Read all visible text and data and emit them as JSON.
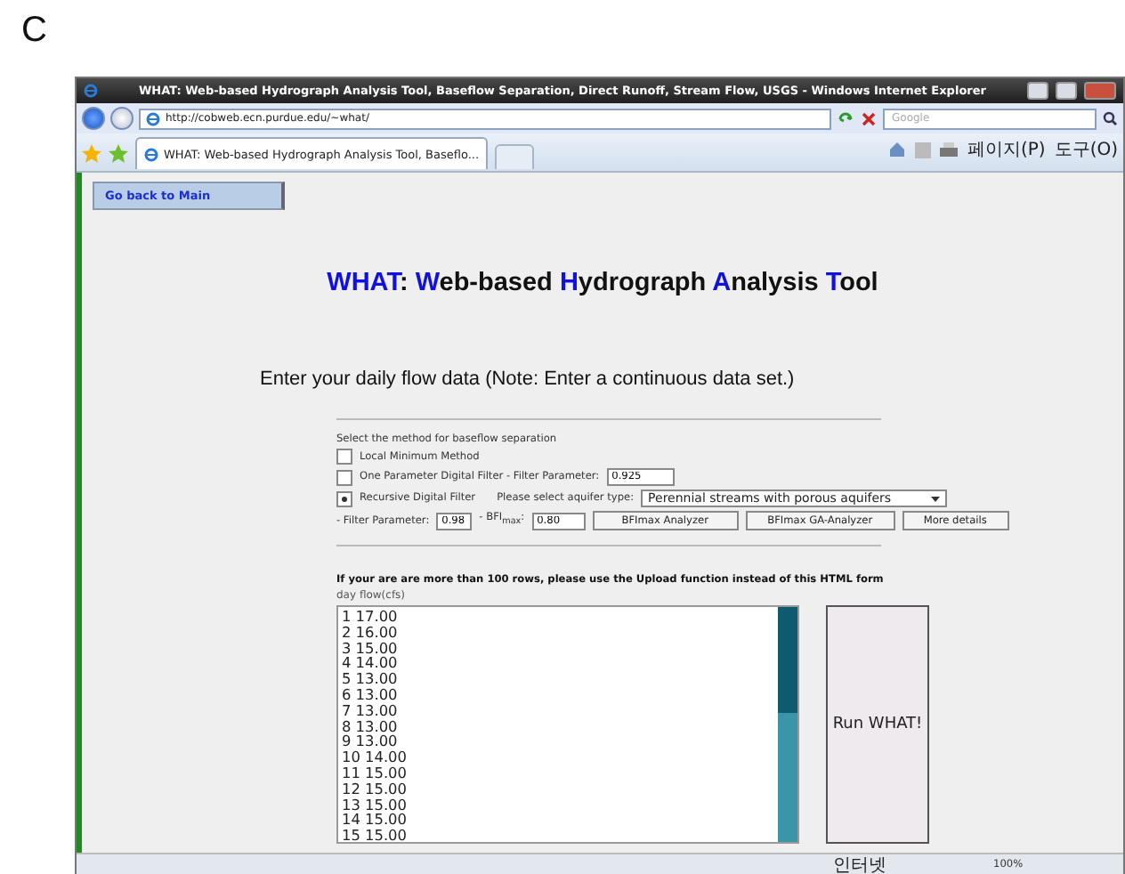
{
  "figure_label": "C",
  "window": {
    "title": "WHAT: Web-based Hydrograph Analysis Tool, Baseflow Separation, Direct Runoff, Stream Flow, USGS - Windows Internet Explorer"
  },
  "address_bar": {
    "url": "http://cobweb.ecn.purdue.edu/~what/",
    "search_placeholder": "Google"
  },
  "tabs": [
    {
      "label": "WHAT: Web-based Hydrograph Analysis Tool, Baseflo...",
      "selected": true
    }
  ],
  "command_bar": {
    "page_menu": "페이지(P)",
    "tools_menu": "도구(O)"
  },
  "page": {
    "back_link": "Go back to Main",
    "title": [
      {
        "text": "W",
        "highlight": true
      },
      {
        "text": "HAT",
        "highlight": true
      },
      {
        "text": ": ",
        "highlight": false
      },
      {
        "text": "W",
        "highlight": true
      },
      {
        "text": "eb-based ",
        "highlight": false
      },
      {
        "text": "H",
        "highlight": true
      },
      {
        "text": "ydrograph ",
        "highlight": false
      },
      {
        "text": "A",
        "highlight": true
      },
      {
        "text": "nalysis ",
        "highlight": false
      },
      {
        "text": "T",
        "highlight": true
      },
      {
        "text": "ool",
        "highlight": false
      }
    ],
    "intro": "Enter your daily flow data (Note: Enter a continuous data set.)",
    "method_prompt": "Select the method for baseflow separation",
    "methods": [
      {
        "label": "Local Minimum Method",
        "selected": false
      },
      {
        "label": "One Parameter Digital Filter - Filter Parameter:",
        "selected": false,
        "value": "0.925"
      },
      {
        "label": "Recursive Digital Filter",
        "selected": true,
        "aquifer_label": "Please select aquifer type:",
        "aquifer": "Perennial streams with porous aquifers"
      }
    ],
    "filter_label": "- Filter Parameter:",
    "filter_value": "0.98",
    "bfi_label": "- BFI$_{max}$:",
    "bfi_value": "0.80",
    "buttons": [
      "BFImax Analyzer",
      "BFImax GA-Analyzer",
      "More details"
    ],
    "notice": "If your are are more than 100 rows, please use the Upload function instead of this HTML form",
    "data_header": "day flow(cfs)",
    "data_rows": [
      "1 17.00",
      "2 16.00",
      "3 15.00",
      "4 14.00",
      "5 13.00",
      "6 13.00",
      "7 13.00",
      "8 13.00",
      "9 13.00",
      "10 14.00",
      "11 15.00",
      "12 15.00",
      "13 15.00",
      "14 15.00",
      "15 15.00"
    ],
    "run_button": "Run WHAT!"
  },
  "status_bar": {
    "zone": "인터넷",
    "zoom": "100%"
  }
}
